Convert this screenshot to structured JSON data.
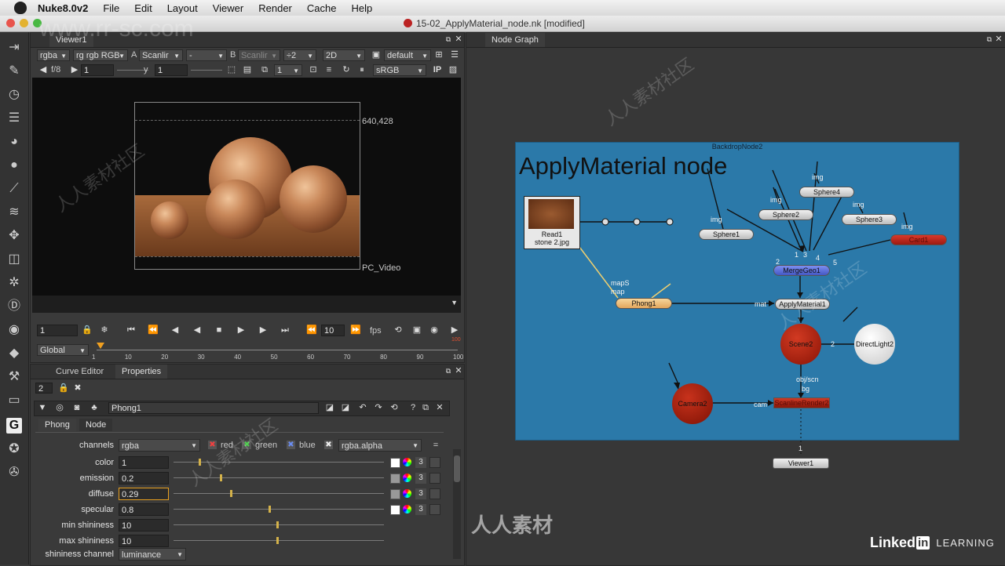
{
  "menubar": {
    "app": "Nuke8.0v2",
    "items": [
      "File",
      "Edit",
      "Layout",
      "Viewer",
      "Render",
      "Cache",
      "Help"
    ]
  },
  "window": {
    "title": "15-02_ApplyMaterial_node.nk [modified]"
  },
  "viewer": {
    "tab": "Viewer1",
    "channels": "rgba",
    "layer": "rgb RGB",
    "layer_prefix": "rg",
    "input_a_label": "A",
    "input_a": "Scanlir",
    "input_a_op": "-",
    "input_b_label": "B",
    "input_b": "Scanlir",
    "zoom_op": "÷2",
    "view_mode": "2D",
    "lut": "default",
    "fstop": "f/8",
    "gain": "1",
    "gamma_label": "y",
    "gamma": "1",
    "proxy": "1",
    "display": "sRGB",
    "ip_label": "IP",
    "format_size": "640,428",
    "format_name": "PC_Video"
  },
  "timeline": {
    "frame": "1",
    "step": "10",
    "fps_label": "fps",
    "range_mode": "Global",
    "ticks": [
      "1",
      "10",
      "20",
      "30",
      "40",
      "50",
      "60",
      "70",
      "80",
      "90",
      "100"
    ],
    "end_marker": "100"
  },
  "props_tabs": [
    "Curve Editor",
    "Properties"
  ],
  "props_header": {
    "max_panels": "2",
    "node_name": "Phong1"
  },
  "phong": {
    "tabs": [
      "Phong",
      "Node"
    ],
    "channels": {
      "label": "channels",
      "value": "rgba",
      "checks": [
        "red",
        "green",
        "blue"
      ],
      "alpha": "rgba.alpha",
      "link": "="
    },
    "params": [
      {
        "label": "color",
        "value": "1",
        "level": 0.12
      },
      {
        "label": "emission",
        "value": "0.2",
        "level": 0.22
      },
      {
        "label": "diffuse",
        "value": "0.29",
        "level": 0.27
      },
      {
        "label": "specular",
        "value": "0.8",
        "level": 0.45
      }
    ],
    "rounds": [
      {
        "label": "min shininess",
        "value": "10",
        "level": 0.49
      },
      {
        "label": "max shininess",
        "value": "10",
        "level": 0.49
      }
    ],
    "shininess_channel": {
      "label": "shininess channel",
      "value": "luminance"
    },
    "three": "3"
  },
  "nodegraph": {
    "tab": "Node Graph",
    "backdrop_name": "BackdropNode2",
    "backdrop_title": "ApplyMaterial node",
    "read_node": {
      "name": "Read1",
      "file": "stone 2.jpg"
    },
    "nodes": {
      "phong": "Phong1",
      "sphere1": "Sphere1",
      "sphere2": "Sphere2",
      "sphere3": "Sphere3",
      "sphere4": "Sphere4",
      "card": "Card1",
      "merge": "MergeGeo1",
      "apply": "ApplyMaterial1",
      "scene": "Scene2",
      "light": "DirectLight2",
      "camera": "Camera2",
      "render": "ScanlineRender2",
      "viewer": "Viewer1"
    },
    "edge_labels": {
      "img": "img",
      "map": "map",
      "mapS": "mapS",
      "mat": "mat",
      "objscn": "obj/scn",
      "bg": "bg",
      "cam": "cam",
      "in1": "1",
      "in2": "2",
      "in3": "3",
      "in4": "4",
      "in5": "5",
      "scene_in": "2",
      "viewer_in": "1"
    }
  },
  "watermarks": {
    "site": "www.rr-sc.com",
    "brand": "人人素材",
    "brand_tile": "人人素材社区"
  },
  "linkedin": {
    "name": "Linked",
    "in": "in",
    "tag": "LEARNING"
  },
  "colors": {
    "backdrop": "#2b79a9",
    "merge_node": "#5a6fd2",
    "phong_node": "#f0c07a",
    "card_node": "#c0261a",
    "scene_node": "#b8200f",
    "render_node": "#c0261a"
  }
}
